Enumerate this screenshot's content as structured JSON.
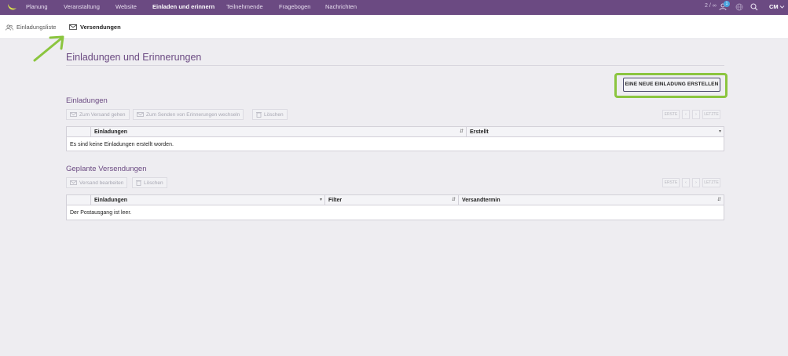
{
  "topnav": {
    "items": [
      "Planung",
      "Veranstaltung",
      "Website",
      "Einladen und erinnern",
      "Teilnehmende",
      "Fragebogen",
      "Nachrichten"
    ],
    "counter": "2 / ∞",
    "notification_count": "1",
    "user_initials": "CM"
  },
  "subnav": {
    "items": [
      "Einladungsliste",
      "Versendungen"
    ]
  },
  "main": {
    "title": "Einladungen und Erinnerungen",
    "create_button": "EINE NEUE EINLADUNG ERSTELLEN",
    "invitations": {
      "title": "Einladungen",
      "toolbar": [
        "Zum Versand gehen",
        "Zum Senden von Erinnerungen wechseln",
        "Löschen"
      ],
      "pager": [
        "ERSTE",
        "‹",
        "›",
        "LETZTE"
      ],
      "columns": [
        "Einladungen",
        "Erstellt"
      ],
      "empty_message": "Es sind keine Einladungen erstellt worden."
    },
    "scheduled": {
      "title": "Geplante Versendungen",
      "toolbar": [
        "Versand bearbeiten",
        "Löschen"
      ],
      "pager": [
        "ERSTE",
        "‹",
        "›",
        "LETZTE"
      ],
      "columns": [
        "Einladungen",
        "Filter",
        "Versandtermin"
      ],
      "empty_message": "Der Postausgang ist leer."
    }
  },
  "colors": {
    "brand": "#6b4a82",
    "highlight": "#8bc53f",
    "background": "#eeedf1"
  },
  "icons": [
    "logo-icon",
    "notifications-icon",
    "globe-icon",
    "search-icon",
    "chevron-down-icon",
    "users-icon",
    "envelope-icon",
    "trash-icon",
    "sort-icon",
    "annotation-arrow"
  ]
}
